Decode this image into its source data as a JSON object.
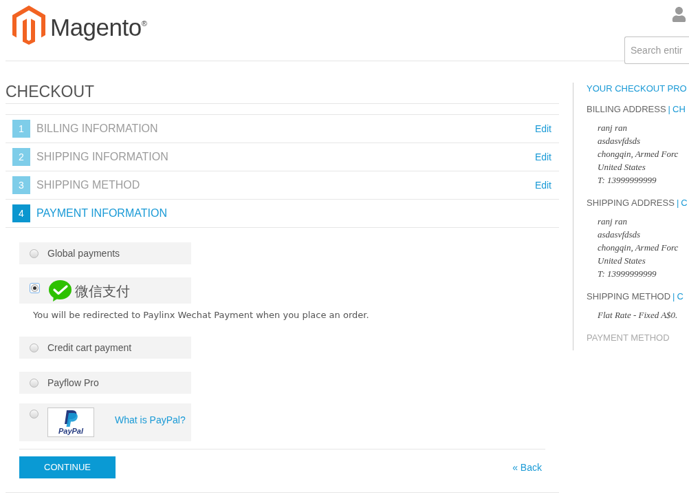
{
  "header": {
    "logo": {
      "wordmark": "Magento",
      "mark": "®"
    },
    "search": {
      "placeholder": "Search entir"
    }
  },
  "checkout": {
    "title": "CHECKOUT",
    "steps": [
      {
        "number": "1",
        "title": "BILLING INFORMATION",
        "selected": false,
        "action": "Edit"
      },
      {
        "number": "2",
        "title": "SHIPPING INFORMATION",
        "selected": false,
        "action": "Edit"
      },
      {
        "number": "3",
        "title": "SHIPPING METHOD",
        "selected": false,
        "action": "Edit"
      },
      {
        "number": "4",
        "title": "PAYMENT INFORMATION",
        "selected": true
      }
    ],
    "payment_methods": [
      {
        "kind": "text",
        "label": "Global payments",
        "selected": false
      },
      {
        "kind": "wechat",
        "label": "微信支付",
        "selected": true,
        "note": "You will be redirected to Paylinx Wechat Payment when you place an order."
      },
      {
        "kind": "text",
        "label": "Credit cart payment",
        "selected": false
      },
      {
        "kind": "text",
        "label": "Payflow Pro",
        "selected": false
      },
      {
        "kind": "paypal",
        "logo_text": "PayPal",
        "link": "What is PayPal?",
        "selected": false
      }
    ],
    "continue_button": "CONTINUE",
    "back_link": "« Back"
  },
  "sidebar": {
    "title": "YOUR CHECKOUT PRO",
    "sections": [
      {
        "heading": "BILLING ADDRESS",
        "separator": "|",
        "link": "CH",
        "complete": true,
        "lines": [
          "ranj ran",
          "asdasvfdsds",
          "chongqin, Armed Forc",
          "United States",
          "T: 13999999999"
        ]
      },
      {
        "heading": "SHIPPING ADDRESS",
        "separator": "|",
        "link": "C",
        "complete": true,
        "lines": [
          "ranj ran",
          "asdasvfdsds",
          "chongqin, Armed Forc",
          "United States",
          "T: 13999999999"
        ]
      },
      {
        "heading": "SHIPPING METHOD",
        "separator": "|",
        "link": "C",
        "complete": true,
        "lines": [
          "Flat Rate - Fixed A$0."
        ]
      },
      {
        "heading": "PAYMENT METHOD",
        "complete": false
      }
    ]
  }
}
